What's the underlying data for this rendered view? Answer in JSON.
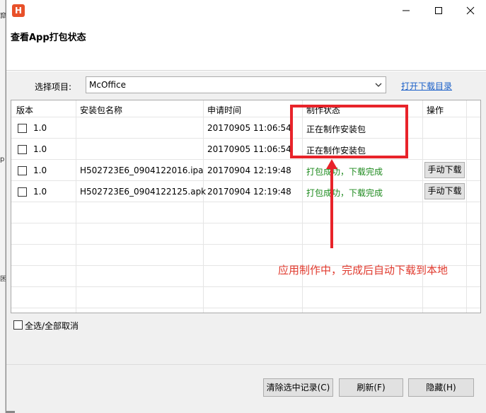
{
  "window": {
    "title_icon_letter": "H",
    "header_title": "查看App打包状态"
  },
  "project": {
    "label": "选择项目:",
    "selected": "McOffice",
    "open_dir_link": "打开下载目录"
  },
  "table": {
    "headers": [
      "版本",
      "安装包名称",
      "申请时间",
      "制作状态",
      "操作"
    ],
    "rows": [
      {
        "version": "1.0",
        "name": "",
        "time": "20170905 11:06:54",
        "status": "正在制作安装包",
        "action": ""
      },
      {
        "version": "1.0",
        "name": "",
        "time": "20170905 11:06:54",
        "status": "正在制作安装包",
        "action": ""
      },
      {
        "version": "1.0",
        "name": "H502723E6_0904122016.ipa",
        "time": "20170904 12:19:48",
        "status": "打包成功，下载完成",
        "action": "手动下载"
      },
      {
        "version": "1.0",
        "name": "H502723E6_0904122125.apk",
        "time": "20170904 12:19:48",
        "status": "打包成功，下载完成",
        "action": "手动下载"
      }
    ]
  },
  "select_all_label": "全选/全部取消",
  "buttons": {
    "clear": "清除选中记录(C)",
    "refresh": "刷新(F)",
    "hide": "隐藏(H)"
  },
  "annotation": {
    "text": "应用制作中，完成后自动下载到本地",
    "color": "#e8232a"
  },
  "colors": {
    "success": "#1e8a1e",
    "link": "#1a5fc8"
  },
  "background_strip_glyphs": [
    "窟",
    "p",
    "困"
  ]
}
